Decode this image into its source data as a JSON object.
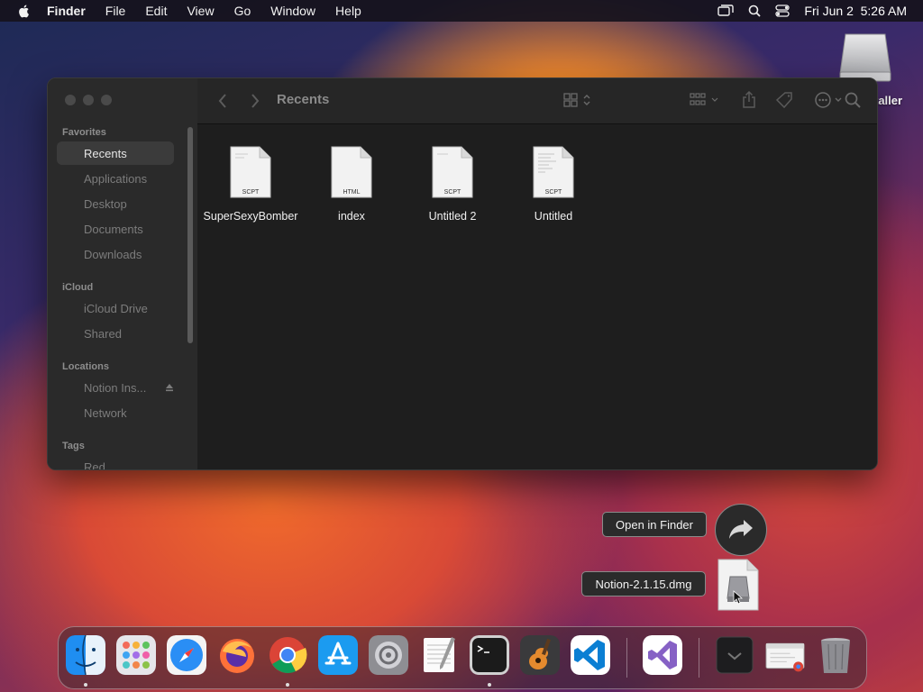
{
  "menubar": {
    "app_name": "Finder",
    "menus": [
      "File",
      "Edit",
      "View",
      "Go",
      "Window",
      "Help"
    ],
    "datetime": "Fri Jun 2  5:26 AM"
  },
  "desktop": {
    "installer_label": "taller"
  },
  "finder": {
    "title": "Recents",
    "sidebar": {
      "favorites_header": "Favorites",
      "favorites": [
        "Recents",
        "Applications",
        "Desktop",
        "Documents",
        "Downloads"
      ],
      "icloud_header": "iCloud",
      "icloud": [
        "iCloud Drive",
        "Shared"
      ],
      "locations_header": "Locations",
      "locations": [
        "Notion Ins...",
        "Network"
      ],
      "tags_header": "Tags",
      "tags": [
        "Red"
      ]
    },
    "files": [
      {
        "name": "SuperSexyBomber",
        "type": "SCPT"
      },
      {
        "name": "index",
        "type": "HTML"
      },
      {
        "name": "Untitled 2",
        "type": "SCPT"
      },
      {
        "name": "Untitled",
        "type": "SCPT"
      }
    ]
  },
  "download": {
    "open_label": "Open in Finder",
    "file_label": "Notion-2.1.15.dmg"
  },
  "dock": {
    "apps": [
      "finder",
      "launchpad",
      "safari",
      "firefox",
      "chrome",
      "app-store",
      "system-settings",
      "textedit",
      "terminal",
      "garageband",
      "vscode",
      "visual-studio",
      "downloads-stack",
      "chrome-window",
      "trash"
    ]
  },
  "colors": {
    "accent_selection": "#3b3b3b",
    "window_bg": "#1e1e1e"
  }
}
